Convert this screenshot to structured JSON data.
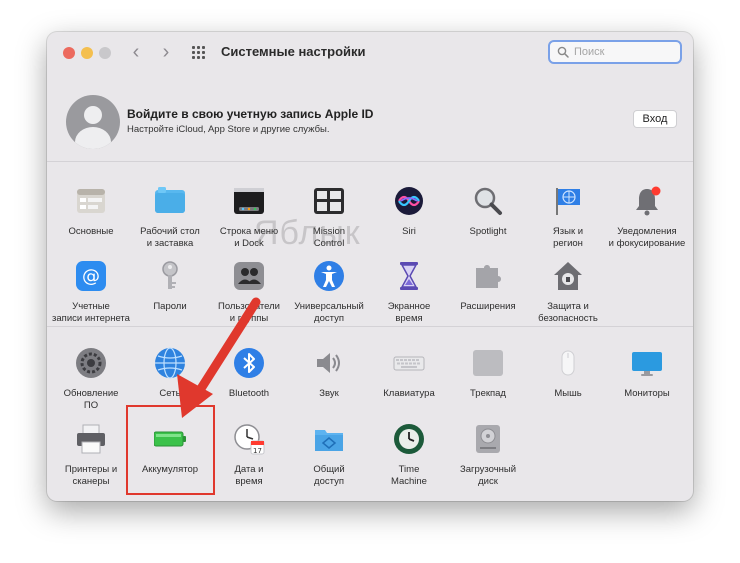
{
  "window": {
    "title": "Системные настройки"
  },
  "search": {
    "placeholder": "Поиск"
  },
  "apple_id": {
    "title": "Войдите в свою учетную запись Apple ID",
    "subtitle": "Настройте iCloud, App Store и другие службы.",
    "login_label": "Вход"
  },
  "watermark": "Яблык",
  "rows": {
    "r1": [
      {
        "label": "Основные",
        "icon": "general-icon"
      },
      {
        "label": "Рабочий стол\nи заставка",
        "icon": "desktop-icon"
      },
      {
        "label": "Строка меню\nи Dock",
        "icon": "dock-icon"
      },
      {
        "label": "Mission\nControl",
        "icon": "mission-control-icon"
      },
      {
        "label": "Siri",
        "icon": "siri-icon"
      },
      {
        "label": "Spotlight",
        "icon": "spotlight-icon"
      },
      {
        "label": "Язык и\nрегион",
        "icon": "language-flag-icon"
      },
      {
        "label": "Уведомления\nи фокусирование",
        "icon": "bell-icon"
      }
    ],
    "r2": [
      {
        "label": "Учетные\nзаписи интернета",
        "icon": "at-icon"
      },
      {
        "label": "Пароли",
        "icon": "key-icon"
      },
      {
        "label": "Пользователи\nи группы",
        "icon": "users-icon"
      },
      {
        "label": "Универсальный\nдоступ",
        "icon": "accessibility-icon"
      },
      {
        "label": "Экранное\nвремя",
        "icon": "hourglass-icon"
      },
      {
        "label": "Расширения",
        "icon": "puzzle-icon"
      },
      {
        "label": "Защита и\nбезопасность",
        "icon": "house-lock-icon"
      }
    ],
    "r3": [
      {
        "label": "Обновление\nПО",
        "icon": "software-update-icon"
      },
      {
        "label": "Сеть",
        "icon": "globe-icon"
      },
      {
        "label": "Bluetooth",
        "icon": "bluetooth-icon"
      },
      {
        "label": "Звук",
        "icon": "speaker-icon"
      },
      {
        "label": "Клавиатура",
        "icon": "keyboard-icon"
      },
      {
        "label": "Трекпад",
        "icon": "trackpad-icon"
      },
      {
        "label": "Мышь",
        "icon": "mouse-icon"
      },
      {
        "label": "Мониторы",
        "icon": "monitor-icon"
      }
    ],
    "r4": [
      {
        "label": "Принтеры и\nсканеры",
        "icon": "printer-icon"
      },
      {
        "label": "Аккумулятор",
        "icon": "battery-icon"
      },
      {
        "label": "Дата и\nвремя",
        "icon": "clock-calendar-icon"
      },
      {
        "label": "Общий\nдоступ",
        "icon": "sharing-folder-icon"
      },
      {
        "label": "Time\nMachine",
        "icon": "time-machine-icon"
      },
      {
        "label": "Загрузочный\nдиск",
        "icon": "disk-icon"
      }
    ]
  },
  "calendar_day": "17",
  "colors": {
    "highlight": "#e0382d",
    "window_bg": "#e9e7ea",
    "accent": "#7aa1e8"
  }
}
